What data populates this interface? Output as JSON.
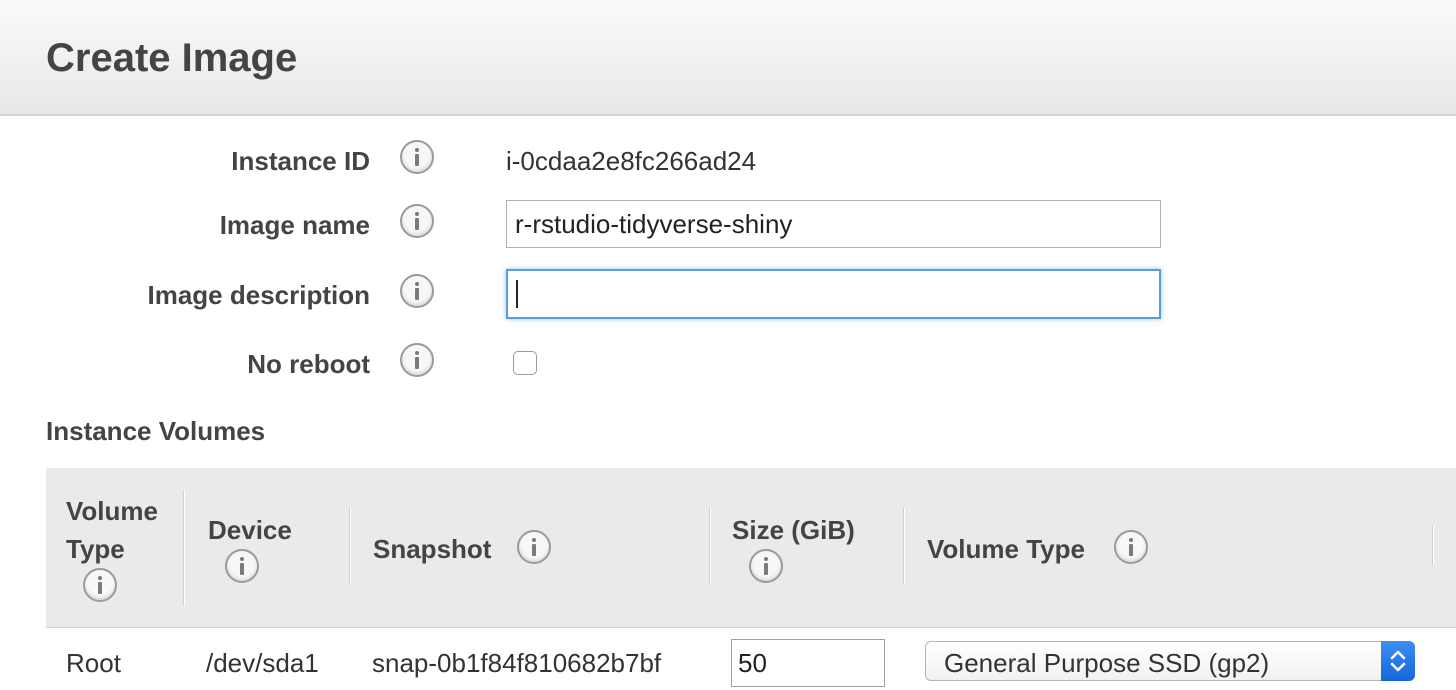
{
  "window": {
    "title": "Create Image"
  },
  "form": {
    "instance_id": {
      "label": "Instance ID",
      "value": "i-0cdaa2e8fc266ad24"
    },
    "image_name": {
      "label": "Image name",
      "value": "r-rstudio-tidyverse-shiny"
    },
    "image_description": {
      "label": "Image description",
      "value": ""
    },
    "no_reboot": {
      "label": "No reboot",
      "checked": false
    }
  },
  "volumes": {
    "title": "Instance Volumes",
    "columns": {
      "volume_type_line1": "Volume",
      "volume_type_line2": "Type",
      "device": "Device",
      "snapshot": "Snapshot",
      "size": "Size (GiB)",
      "volume_type": "Volume Type"
    },
    "rows": [
      {
        "volume_type": "Root",
        "device": "/dev/sda1",
        "snapshot": "snap-0b1f84f810682b7bf",
        "size": "50",
        "ebs_type": "General Purpose SSD (gp2)"
      }
    ]
  },
  "icons": {
    "info": "info-icon",
    "select_arrows": "chevron-up-down-icon"
  },
  "colors": {
    "focus_border": "#5b9dd9",
    "select_arrow": "#1f74e6",
    "header_bg": "#eeeeee",
    "table_header_bg": "#eaeaea"
  }
}
